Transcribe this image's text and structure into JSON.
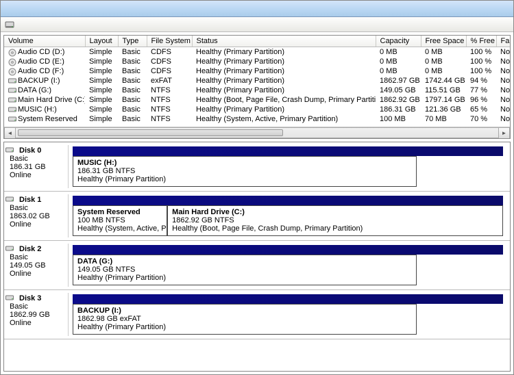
{
  "columns": {
    "volume": "Volume",
    "layout": "Layout",
    "type": "Type",
    "fs": "File System",
    "status": "Status",
    "capacity": "Capacity",
    "free": "Free Space",
    "pctfree": "% Free",
    "fault": "Fault T"
  },
  "volumes": [
    {
      "icon": "cd",
      "name": "Audio CD (D:)",
      "layout": "Simple",
      "type": "Basic",
      "fs": "CDFS",
      "status": "Healthy (Primary Partition)",
      "cap": "0 MB",
      "free": "0 MB",
      "pct": "100 %",
      "fault": "No"
    },
    {
      "icon": "cd",
      "name": "Audio CD (E:)",
      "layout": "Simple",
      "type": "Basic",
      "fs": "CDFS",
      "status": "Healthy (Primary Partition)",
      "cap": "0 MB",
      "free": "0 MB",
      "pct": "100 %",
      "fault": "No"
    },
    {
      "icon": "cd",
      "name": "Audio CD (F:)",
      "layout": "Simple",
      "type": "Basic",
      "fs": "CDFS",
      "status": "Healthy (Primary Partition)",
      "cap": "0 MB",
      "free": "0 MB",
      "pct": "100 %",
      "fault": "No"
    },
    {
      "icon": "hdd",
      "name": "BACKUP (I:)",
      "layout": "Simple",
      "type": "Basic",
      "fs": "exFAT",
      "status": "Healthy (Primary Partition)",
      "cap": "1862.97 GB",
      "free": "1742.44 GB",
      "pct": "94 %",
      "fault": "No"
    },
    {
      "icon": "hdd",
      "name": "DATA (G:)",
      "layout": "Simple",
      "type": "Basic",
      "fs": "NTFS",
      "status": "Healthy (Primary Partition)",
      "cap": "149.05 GB",
      "free": "115.51 GB",
      "pct": "77 %",
      "fault": "No"
    },
    {
      "icon": "hdd",
      "name": "Main Hard Drive (C:)",
      "layout": "Simple",
      "type": "Basic",
      "fs": "NTFS",
      "status": "Healthy (Boot, Page File, Crash Dump, Primary Partition)",
      "cap": "1862.92 GB",
      "free": "1797.14 GB",
      "pct": "96 %",
      "fault": "No"
    },
    {
      "icon": "hdd",
      "name": "MUSIC (H:)",
      "layout": "Simple",
      "type": "Basic",
      "fs": "NTFS",
      "status": "Healthy (Primary Partition)",
      "cap": "186.31 GB",
      "free": "121.36 GB",
      "pct": "65 %",
      "fault": "No"
    },
    {
      "icon": "hdd",
      "name": "System Reserved",
      "layout": "Simple",
      "type": "Basic",
      "fs": "NTFS",
      "status": "Healthy (System, Active, Primary Partition)",
      "cap": "100 MB",
      "free": "70 MB",
      "pct": "70 %",
      "fault": "No"
    }
  ],
  "disks": [
    {
      "name": "Disk 0",
      "type": "Basic",
      "size": "186.31 GB",
      "status": "Online",
      "partitions": [
        {
          "name": "MUSIC  (H:)",
          "detail": "186.31 GB NTFS",
          "status": "Healthy (Primary Partition)",
          "width": "80%"
        }
      ]
    },
    {
      "name": "Disk 1",
      "type": "Basic",
      "size": "1863.02 GB",
      "status": "Online",
      "partitions": [
        {
          "name": "System Reserved",
          "detail": "100 MB NTFS",
          "status": "Healthy (System, Active, Prim",
          "width": "22%"
        },
        {
          "name": "Main Hard Drive  (C:)",
          "detail": "1862.92 GB NTFS",
          "status": "Healthy (Boot, Page File, Crash Dump, Primary Partition)",
          "width": "78%"
        }
      ]
    },
    {
      "name": "Disk 2",
      "type": "Basic",
      "size": "149.05 GB",
      "status": "Online",
      "partitions": [
        {
          "name": "DATA  (G:)",
          "detail": "149.05 GB NTFS",
          "status": "Healthy (Primary Partition)",
          "width": "80%"
        }
      ]
    },
    {
      "name": "Disk 3",
      "type": "Basic",
      "size": "1862.99 GB",
      "status": "Online",
      "partitions": [
        {
          "name": "BACKUP  (I:)",
          "detail": "1862.98 GB exFAT",
          "status": "Healthy (Primary Partition)",
          "width": "80%"
        }
      ]
    }
  ]
}
